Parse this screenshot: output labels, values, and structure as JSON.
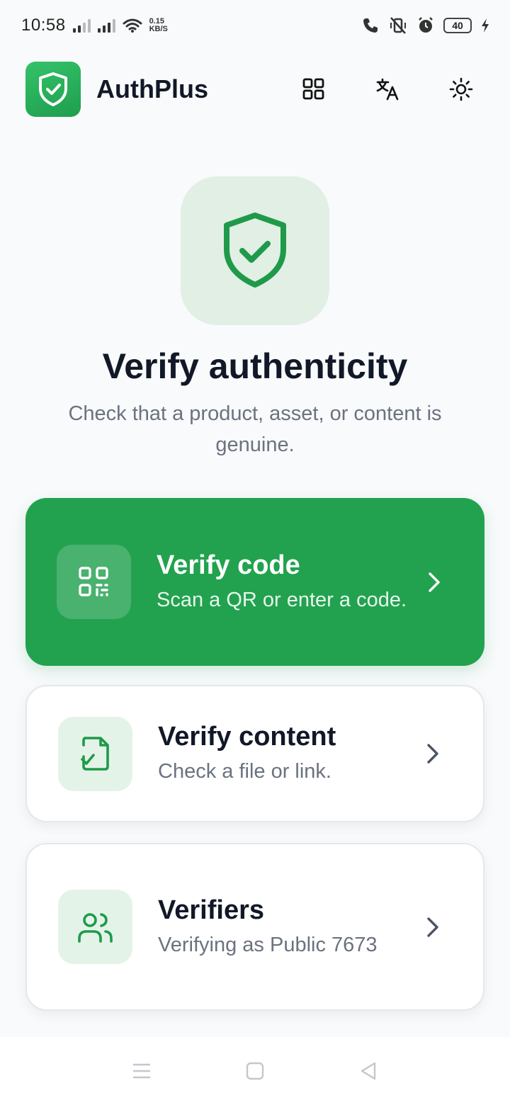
{
  "status_bar": {
    "time": "10:58",
    "net_speed_value": "0.15",
    "net_speed_unit": "KB/S",
    "battery": "40"
  },
  "header": {
    "app_name": "AuthPlus",
    "icons": [
      "shield-check-icon",
      "grid-icon",
      "translate-icon",
      "sun-icon"
    ]
  },
  "hero": {
    "title": "Verify authenticity",
    "subtitle": "Check that a product, asset, or content is genuine."
  },
  "cards": [
    {
      "title": "Verify code",
      "description": "Scan a QR or enter a code.",
      "icon": "qr-code-icon"
    },
    {
      "title": "Verify content",
      "description": "Check a file or link.",
      "icon": "file-check-icon"
    },
    {
      "title": "Verifiers",
      "description": "Verifying as Public 7673",
      "icon": "users-icon"
    }
  ],
  "colors": {
    "primary": "#22a24f",
    "icon_green": "#1f9a4a",
    "background": "#f8fafb",
    "muted_text": "#6b7280"
  },
  "nav_bar": {
    "icons": [
      "menu-icon",
      "home-square-icon",
      "back-triangle-icon"
    ]
  }
}
